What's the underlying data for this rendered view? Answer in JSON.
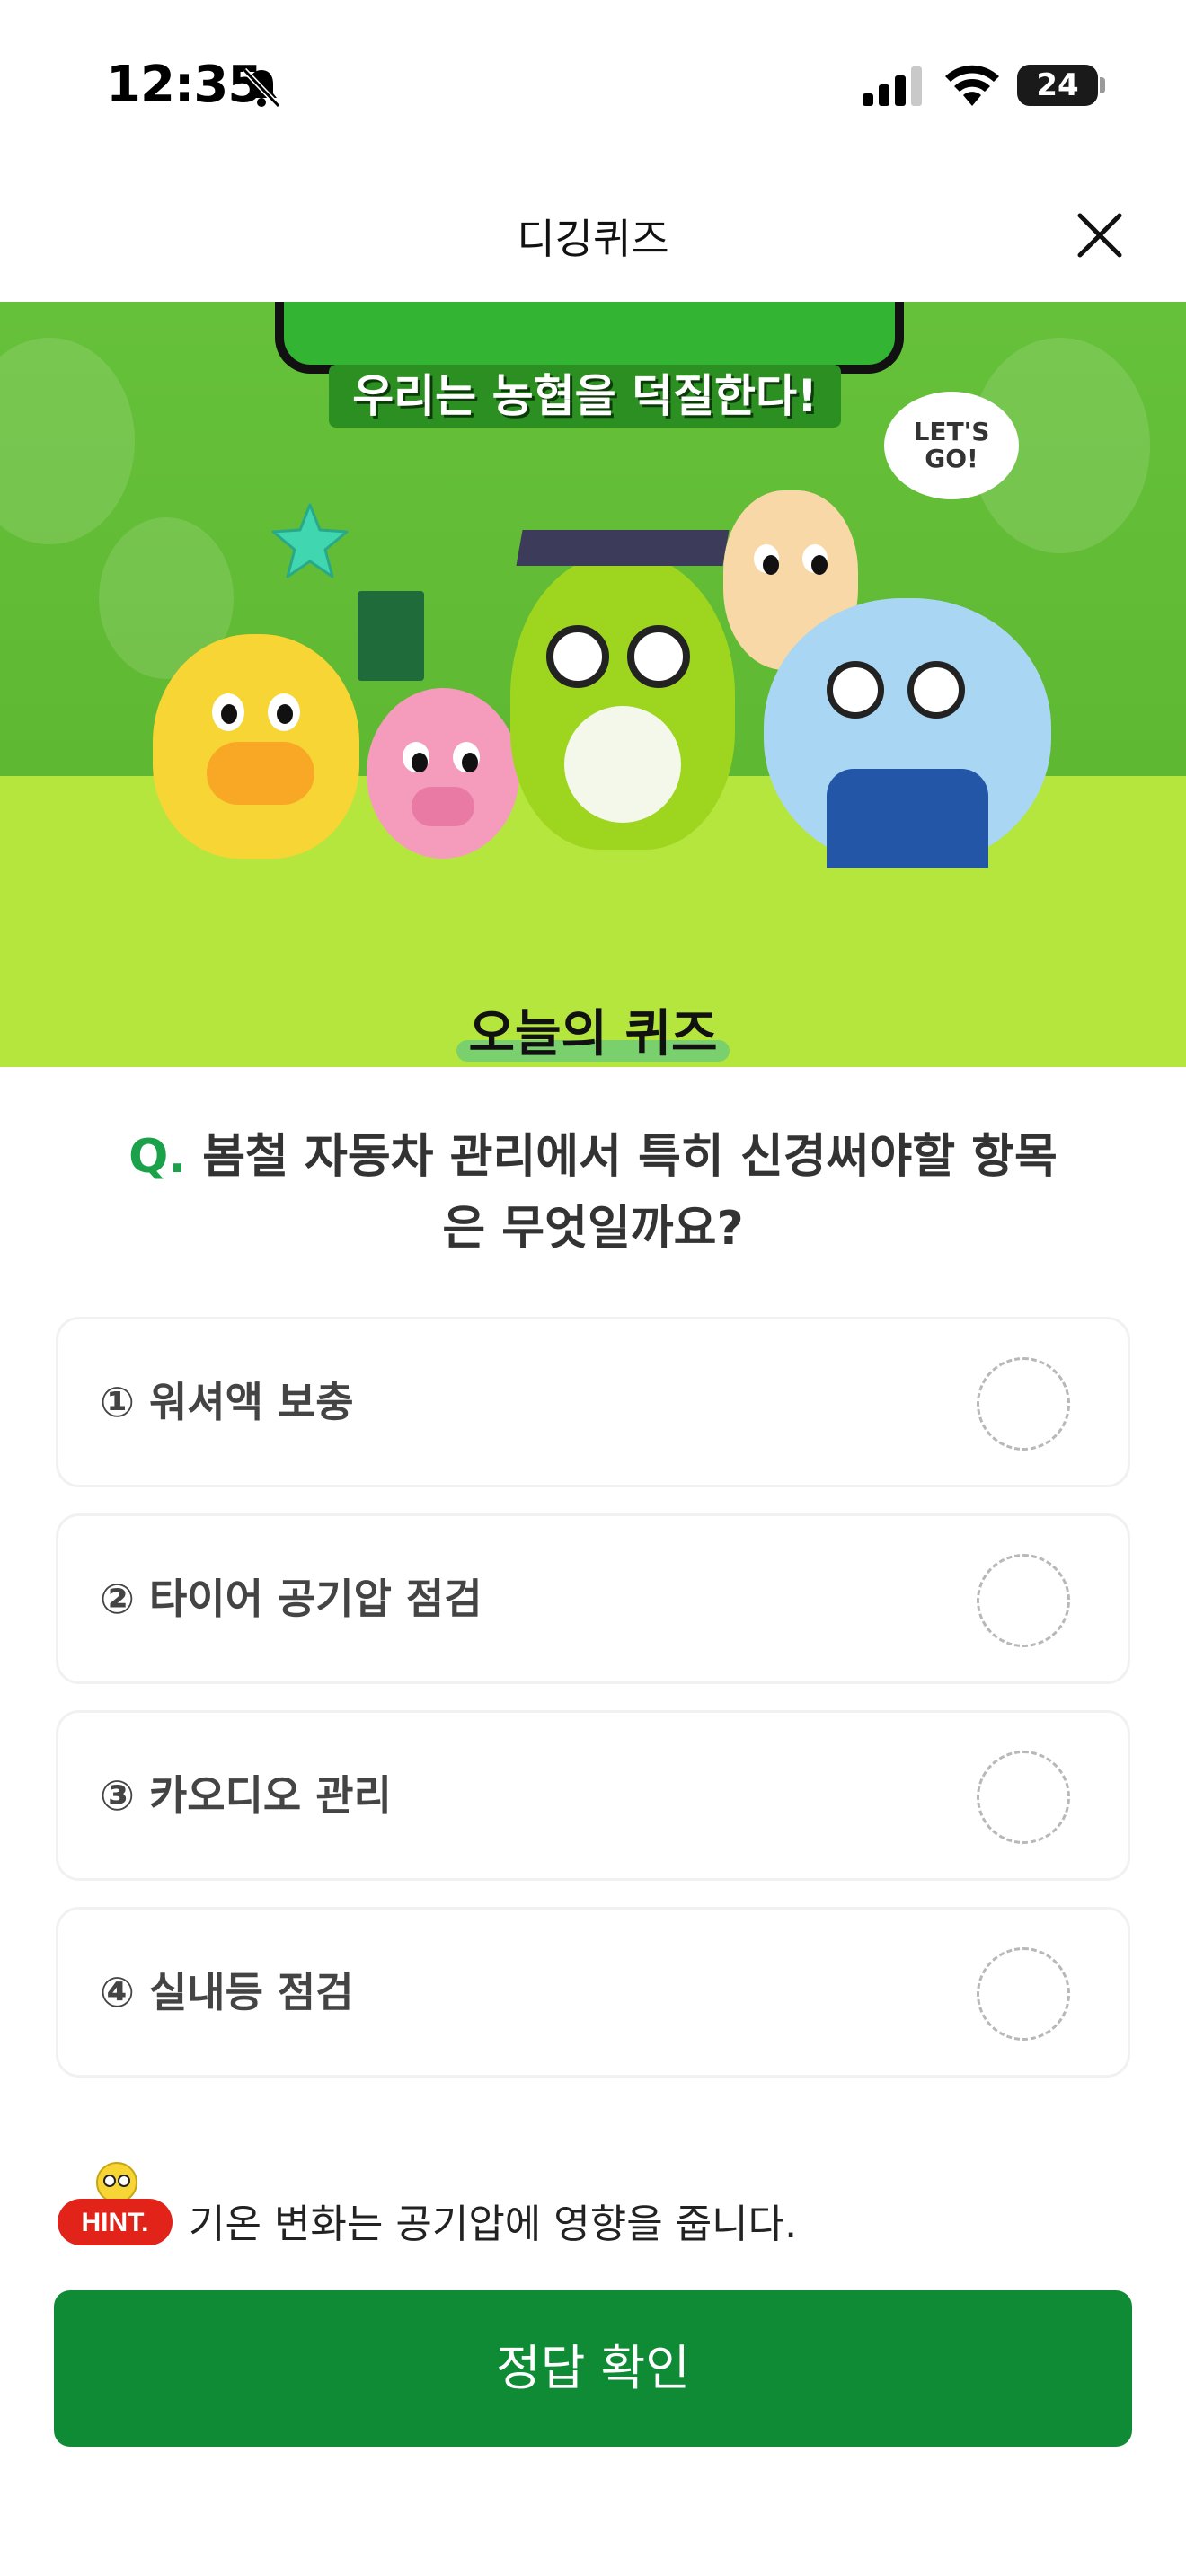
{
  "status_bar": {
    "time": "12:35",
    "battery": "24"
  },
  "header": {
    "title": "디깅퀴즈"
  },
  "banner": {
    "tagline": "우리는 농협을 덕질한다!",
    "bubble": "LET'S GO!"
  },
  "quiz": {
    "card_title": "오늘의 퀴즈",
    "question_prefix": "Q.",
    "question": "봄철 자동차 관리에서 특히 신경써야할 항목은 무엇일까요?",
    "options": [
      {
        "label": "① 워셔액 보충"
      },
      {
        "label": "② 타이어 공기압 점검"
      },
      {
        "label": "③ 카오디오 관리"
      },
      {
        "label": "④ 실내등 점검"
      }
    ],
    "hint_badge": "HINT.",
    "hint": "기온 변화는 공기압에 영향을 줍니다.",
    "submit_label": "정답 확인"
  },
  "colors": {
    "accent": "#0f8a35",
    "banner_green": "#5fb832",
    "banner_lime": "#b5e63d",
    "hint_red": "#e2231a"
  }
}
